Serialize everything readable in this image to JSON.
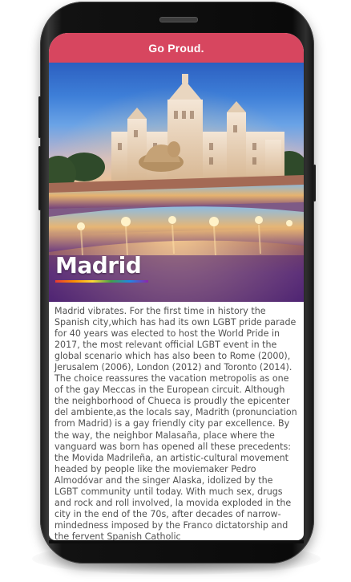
{
  "header": {
    "title": "Go Proud."
  },
  "hero": {
    "city": "Madrid",
    "image_alt": "Cibeles fountain and palace at night in Madrid"
  },
  "content": {
    "body": "Madrid vibrates. For the first time in history the Spanish city,which has had its own LGBT pride parade for 40 years was elected to host the World Pride in 2017, the most relevant official LGBT event in the global scenario which has also been to Rome (2000), Jerusalem (2006), London (2012) and Toronto (2014). The choice reassures the vacation metropolis as one of the gay Meccas in the European circuit. Although the neighborhood of Chueca is proudly the epicenter del ambiente,as the locals say, Madrith (pronunciation from Madrid) is a gay friendly city par excellence. By the way, the neighbor Malasaña, place where the vanguard was born has opened all these precedents: the Movida Madrileña, an artistic-cultural movement headed by people like the moviemaker Pedro Almodóvar and the singer Alaska, idolized by the LGBT community until today. With much sex, drugs and rock and roll involved, la movida exploded in the city in the end of the 70s, after decades of narrow-mindedness imposed by the Franco dictatorship and the fervent Spanish Catholic"
  },
  "colors": {
    "header_bg": "#d7465f",
    "header_text": "#ffffff",
    "body_text": "#505050"
  }
}
